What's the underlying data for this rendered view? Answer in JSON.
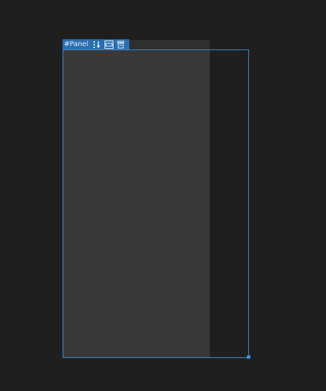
{
  "canvas": {
    "background": "#1f1f1f",
    "panel_color": "#393939",
    "selection_color": "#3d8fd1",
    "tag_color": "#2b6fb0"
  },
  "panel": {
    "tag_label": "#Panel",
    "tools": [
      {
        "name": "reorder-icon"
      },
      {
        "name": "fill-width-icon"
      },
      {
        "name": "delete-icon"
      }
    ]
  }
}
